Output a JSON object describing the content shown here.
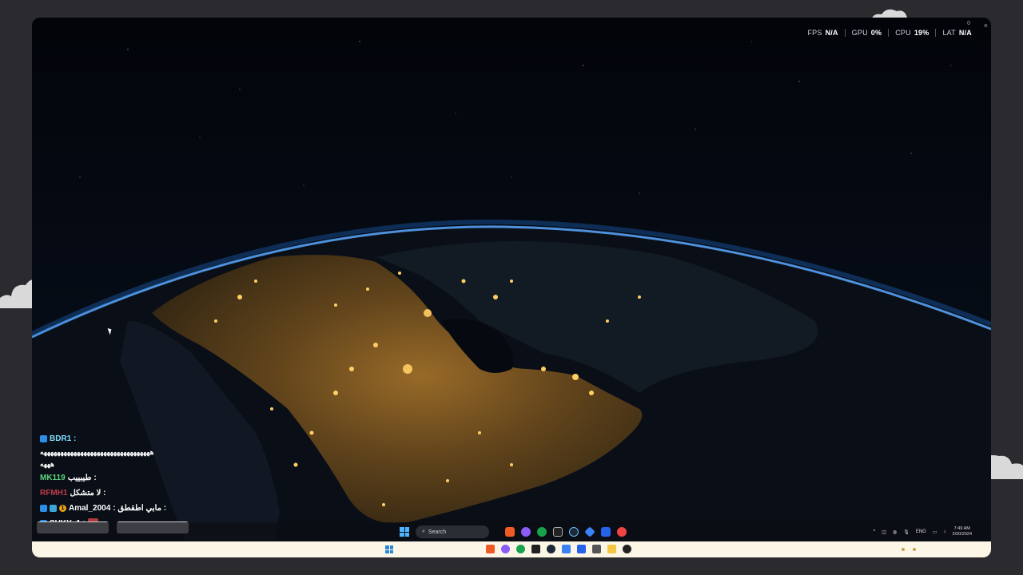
{
  "overlay": {
    "stats": [
      {
        "label": "FPS",
        "value": "N/A"
      },
      {
        "label": "GPU",
        "value": "0%"
      },
      {
        "label": "CPU",
        "value": "19%"
      },
      {
        "label": "LAT",
        "value": "N/A"
      }
    ],
    "close_icon": "×",
    "pin_icon": "0"
  },
  "chat": {
    "messages": [
      {
        "user": "BDR1 :",
        "text": "",
        "user_color": "#7fdcff",
        "badges": [
          "blue"
        ]
      },
      {
        "user": "",
        "text": "هههههههههههههههههههههههههههههههههه\nهههه",
        "user_color": "#ffffff",
        "badges": []
      },
      {
        "user": "MK119",
        "text": "طيبييب :",
        "user_color": "#5bd47c",
        "badges": []
      },
      {
        "user": "RFMH1",
        "text": "لا متشكل :",
        "user_color": "#c23c4b",
        "badges": []
      },
      {
        "user": "Amal_2004",
        "text": ": مابي اطقطق :",
        "user_color": "#ffffff",
        "badges": [
          "blue",
          "cyan",
          "gold"
        ]
      },
      {
        "user": "SUKY_1 :",
        "text": "",
        "user_color": "#ffffff",
        "badges": [
          "blue"
        ]
      }
    ],
    "gold_badge_number": "1"
  },
  "taskbar_inner": {
    "search_placeholder": "Search",
    "tray_lang": "ENG",
    "time": "7:49 AM",
    "date": "2/20/2024"
  },
  "colors": {
    "accent_blue": "#2c8ee6",
    "taskbar_outer_bg": "#fbf6e6",
    "city_light": "#ffcf63"
  }
}
